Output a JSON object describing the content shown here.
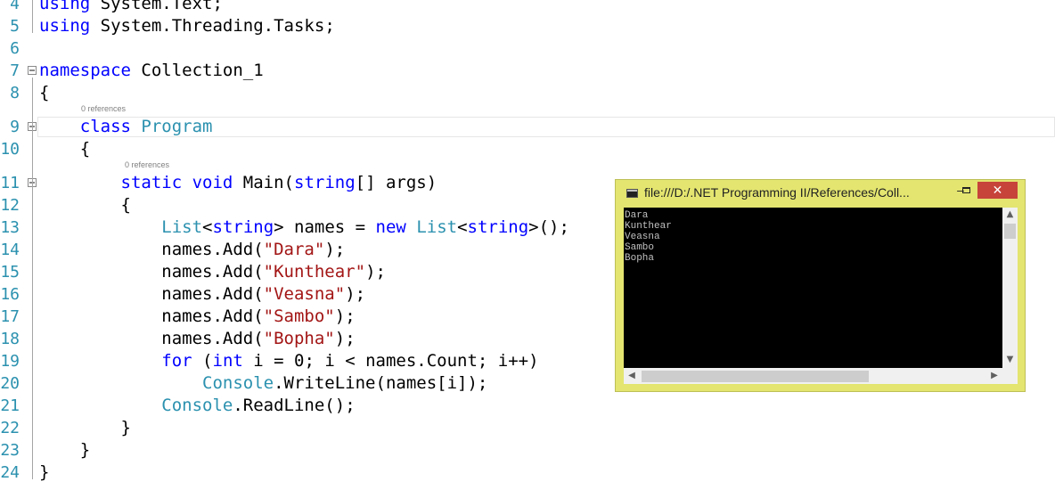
{
  "editor": {
    "lines": [
      {
        "num": "4",
        "parts": [
          [
            "kw",
            "using"
          ],
          [
            "",
            "System.Text;"
          ]
        ]
      },
      {
        "num": "5",
        "parts": [
          [
            "kw",
            "using"
          ],
          [
            "",
            "System.Threading.Tasks;"
          ]
        ]
      },
      {
        "num": "6",
        "parts": []
      },
      {
        "num": "7",
        "parts": [
          [
            "kw",
            "namespace"
          ],
          [
            "",
            " Collection_1"
          ]
        ]
      },
      {
        "num": "8",
        "parts": [
          [
            "",
            "{"
          ]
        ]
      },
      {
        "num": "9",
        "parts": [
          [
            "",
            "    "
          ],
          [
            "kw",
            "class"
          ],
          [
            "",
            ""
          ],
          [
            "ty",
            "Program"
          ]
        ]
      },
      {
        "num": "10",
        "parts": [
          [
            "",
            "    {"
          ]
        ]
      },
      {
        "num": "11",
        "parts": [
          [
            "",
            "        "
          ],
          [
            "kw",
            "static void"
          ],
          [
            "",
            " Main("
          ],
          [
            "kw",
            "string"
          ],
          [
            "",
            "[] args)"
          ]
        ]
      },
      {
        "num": "12",
        "parts": [
          [
            "",
            "        {"
          ]
        ]
      },
      {
        "num": "13",
        "parts": [
          [
            "",
            "            "
          ],
          [
            "ty",
            "List"
          ],
          [
            "",
            "<"
          ],
          [
            "kw",
            "string"
          ],
          [
            "",
            "> names = "
          ],
          [
            "kw",
            "new"
          ],
          [
            "",
            " "
          ],
          [
            "ty",
            "List"
          ],
          [
            "",
            "<"
          ],
          [
            "kw",
            "string"
          ],
          [
            "",
            ">();"
          ]
        ]
      },
      {
        "num": "14",
        "parts": [
          [
            "",
            "            names.Add("
          ],
          [
            "st",
            "\"Dara\""
          ],
          [
            "",
            ");"
          ]
        ]
      },
      {
        "num": "15",
        "parts": [
          [
            "",
            "            names.Add("
          ],
          [
            "st",
            "\"Kunthear\""
          ],
          [
            "",
            ");"
          ]
        ]
      },
      {
        "num": "16",
        "parts": [
          [
            "",
            "            names.Add("
          ],
          [
            "st",
            "\"Veasna\""
          ],
          [
            "",
            ");"
          ]
        ]
      },
      {
        "num": "17",
        "parts": [
          [
            "",
            "            names.Add("
          ],
          [
            "st",
            "\"Sambo\""
          ],
          [
            "",
            ");"
          ]
        ]
      },
      {
        "num": "18",
        "parts": [
          [
            "",
            "            names.Add("
          ],
          [
            "st",
            "\"Bopha\""
          ],
          [
            "",
            ");"
          ]
        ]
      },
      {
        "num": "19",
        "parts": [
          [
            "",
            "            "
          ],
          [
            "kw",
            "for"
          ],
          [
            "",
            " ("
          ],
          [
            "kw",
            "int"
          ],
          [
            "",
            " i = 0; i < names.Count; i++)"
          ]
        ]
      },
      {
        "num": "20",
        "parts": [
          [
            "",
            "                "
          ],
          [
            "ty",
            "Console"
          ],
          [
            "",
            ".WriteLine(names[i]);"
          ]
        ]
      },
      {
        "num": "21",
        "parts": [
          [
            "",
            "            "
          ],
          [
            "ty",
            "Console"
          ],
          [
            "",
            ".ReadLine();"
          ]
        ]
      },
      {
        "num": "22",
        "parts": [
          [
            "",
            "        }"
          ]
        ]
      },
      {
        "num": "23",
        "parts": [
          [
            "",
            "    }"
          ]
        ]
      },
      {
        "num": "24",
        "parts": [
          [
            "",
            "}"
          ]
        ]
      }
    ],
    "codelens_class": "0 references",
    "codelens_main": "0 references"
  },
  "console": {
    "title": "file:///D:/.NET Programming II/References/Coll...",
    "min_label": "–",
    "close_label": "✕",
    "output": [
      "Dara",
      "Kunthear",
      "Veasna",
      "Sambo",
      "Bopha"
    ],
    "scroll_up": "▲",
    "scroll_down": "▼",
    "scroll_left": "◀",
    "scroll_right": "▶"
  }
}
